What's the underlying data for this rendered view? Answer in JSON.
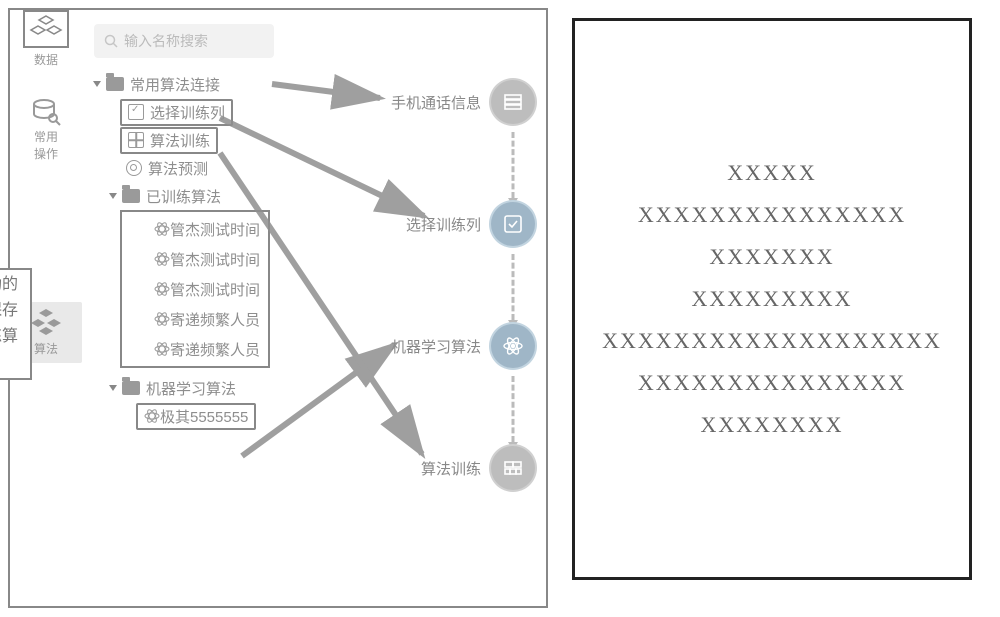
{
  "sidebar": {
    "data_label": "数据",
    "common_ops_label": "常用\n操作",
    "algo_label": "算法"
  },
  "search": {
    "placeholder": "输入名称搜索"
  },
  "tree": {
    "group_common": "常用算法连接",
    "leaf_select_cols": "选择训练列",
    "leaf_train": "算法训练",
    "leaf_predict": "算法预测",
    "group_trained": "已训练算法",
    "trained_items": [
      "管杰测试时间",
      "管杰测试时间",
      "管杰测试时间",
      "寄递频繁人员",
      "寄递频繁人员"
    ],
    "group_ml": "机器学习算法",
    "leaf_ml_item": "极其5555555"
  },
  "tooltip_text": "训练成功的算法会保存在已训练算法",
  "flow": {
    "n1": "手机通话信息",
    "n2": "选择训练列",
    "n3": "机器学习算法",
    "n4": "算法训练"
  },
  "right_lines": [
    "XXXXX",
    "XXXXXXXXXXXXXXX",
    "XXXXXXX",
    "XXXXXXXXX",
    "XXXXXXXXXXXXXXXXXXX",
    "XXXXXXXXXXXXXXX",
    "XXXXXXXX"
  ]
}
